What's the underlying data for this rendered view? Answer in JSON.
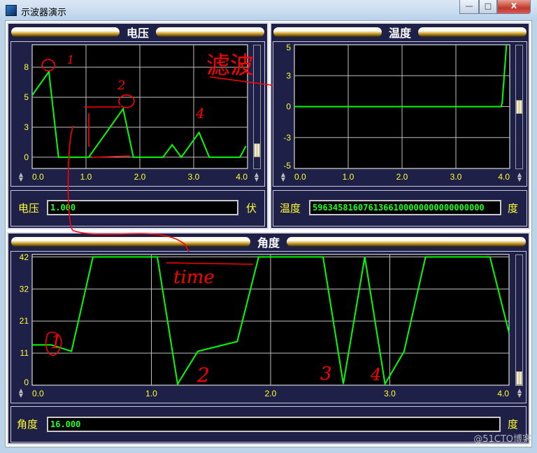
{
  "window": {
    "title": "示波器演示",
    "icon": "oscilloscope-app-icon",
    "buttons": {
      "minimize": "—",
      "maximize": "□",
      "close": "X"
    }
  },
  "colors": {
    "panel": "#1e2048",
    "plot_bg": "#000000",
    "trace": "#00ff00",
    "grid": "#c0c0c0",
    "tick_label": "#ffff30"
  },
  "voltage": {
    "header": "电压",
    "label": "电压",
    "value": "1.000",
    "unit": "伏",
    "scroll_level": 0.85
  },
  "temperature": {
    "header": "温度",
    "label": "温度",
    "value": "5963458160761366100000000000000000",
    "unit": "度",
    "scroll_level": 0.5
  },
  "angle": {
    "header": "角度",
    "label": "角度",
    "value": "16.000",
    "unit": "度",
    "scroll_level": 0.9
  },
  "chart_data": [
    {
      "type": "line",
      "name_cn": "电压",
      "xlim": [
        0,
        4
      ],
      "ylim": [
        -1,
        10
      ],
      "grid": true,
      "xticks": [
        {
          "v": 0,
          "t": "0.0"
        },
        {
          "v": 1,
          "t": "1.0"
        },
        {
          "v": 2,
          "t": "2.0"
        },
        {
          "v": 3,
          "t": "3.0"
        },
        {
          "v": 4,
          "t": "4.0"
        }
      ],
      "yticks": [
        {
          "v": 0,
          "t": "0"
        },
        {
          "v": 2.67,
          "t": "3"
        },
        {
          "v": 5.33,
          "t": "5"
        },
        {
          "v": 8,
          "t": "8"
        }
      ],
      "x": [
        0,
        0.31,
        0.49,
        1.05,
        1.69,
        1.88,
        2.43,
        2.6,
        2.77,
        3.1,
        3.29,
        3.86,
        3.97
      ],
      "y": [
        5.5,
        7.6,
        0,
        0,
        4.3,
        0,
        0,
        1.1,
        0,
        2.2,
        0,
        0,
        1.0
      ]
    },
    {
      "type": "line",
      "name_cn": "温度",
      "xlim": [
        0,
        4
      ],
      "ylim": [
        -5,
        5
      ],
      "grid": true,
      "xticks": [
        {
          "v": 0,
          "t": "0.0"
        },
        {
          "v": 1,
          "t": "1.0"
        },
        {
          "v": 2,
          "t": "2.0"
        },
        {
          "v": 3,
          "t": "3.0"
        },
        {
          "v": 4,
          "t": "4.0"
        }
      ],
      "yticks": [
        {
          "v": -5,
          "t": "-5"
        },
        {
          "v": -2.5,
          "t": "-3"
        },
        {
          "v": 0,
          "t": "0"
        },
        {
          "v": 2.5,
          "t": "3"
        },
        {
          "v": 5,
          "t": "5"
        }
      ],
      "x": [
        0,
        3.84,
        3.86,
        3.94
      ],
      "y": [
        0,
        0,
        0.3,
        5
      ]
    },
    {
      "type": "line",
      "name_cn": "角度",
      "xlim": [
        0,
        4
      ],
      "ylim": [
        0,
        42.8
      ],
      "grid": true,
      "xticks": [
        {
          "v": 0,
          "t": "0.0"
        },
        {
          "v": 1,
          "t": "1.0"
        },
        {
          "v": 2,
          "t": "2.0"
        },
        {
          "v": 3,
          "t": "3.0"
        },
        {
          "v": 4,
          "t": "4.0"
        }
      ],
      "yticks": [
        {
          "v": 0,
          "t": "0"
        },
        {
          "v": 10.5,
          "t": "11"
        },
        {
          "v": 21,
          "t": "21"
        },
        {
          "v": 31.5,
          "t": "32"
        },
        {
          "v": 42,
          "t": "42"
        }
      ],
      "x": [
        0,
        0.16,
        0.33,
        0.51,
        1.05,
        1.22,
        1.39,
        1.72,
        1.9,
        2.44,
        2.61,
        2.79,
        2.96,
        3.12,
        3.3,
        3.84,
        4.0
      ],
      "y": [
        13.2,
        13.2,
        11.1,
        42,
        42,
        0.4,
        11.1,
        14.3,
        42,
        42,
        0.4,
        42,
        0.4,
        11.1,
        42,
        42,
        17.1
      ]
    }
  ],
  "annotations": {
    "filter": "滤波",
    "time": "time",
    "v1": "1",
    "v2": "2",
    "v4": "4",
    "a1": "1",
    "a2": "2",
    "a3": "3",
    "a4": "4"
  },
  "watermark": "@51CTO博客"
}
